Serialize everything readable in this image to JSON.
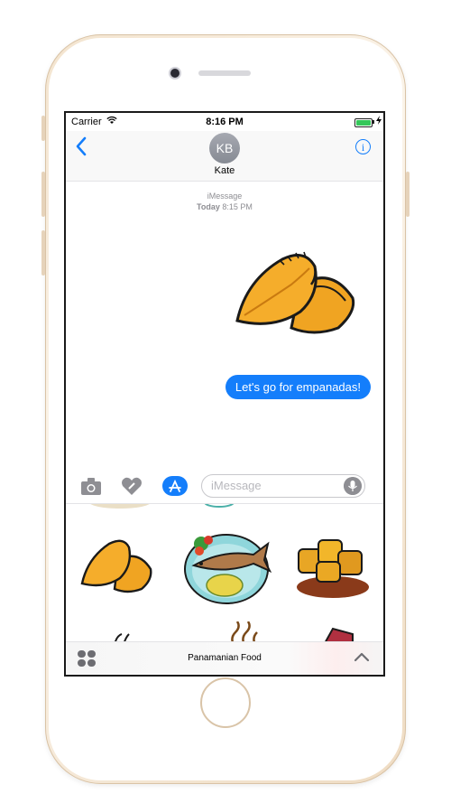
{
  "status_bar": {
    "carrier": "Carrier",
    "time": "8:16 PM"
  },
  "header": {
    "back_icon": "chevron-left-icon",
    "avatar_initials": "KB",
    "contact_name": "Kate",
    "info_icon": "info-icon",
    "info_glyph": "i"
  },
  "conversation": {
    "service_label": "iMessage",
    "timestamp_day": "Today",
    "timestamp_time": "8:15 PM",
    "sticker": "empanadas-sticker",
    "sent_message": "Let's go for empanadas!",
    "bubble_color": "#147efb"
  },
  "input_bar": {
    "placeholder": "iMessage",
    "tools": [
      "camera-icon",
      "digital-touch-icon",
      "app-store-icon"
    ],
    "mic_icon": "microphone-icon"
  },
  "sticker_drawer": {
    "visible_stickers": [
      "empanadas-sticker",
      "fish-plate-sticker",
      "fried-plantain-sticker"
    ]
  },
  "app_tray": {
    "title": "Panamanian Food",
    "apps_icon": "app-grid-icon",
    "expand_icon": "chevron-up-icon"
  },
  "colors": {
    "accent": "#147efb",
    "battery": "#34c759",
    "phone_frame": "#f3e4cf"
  }
}
